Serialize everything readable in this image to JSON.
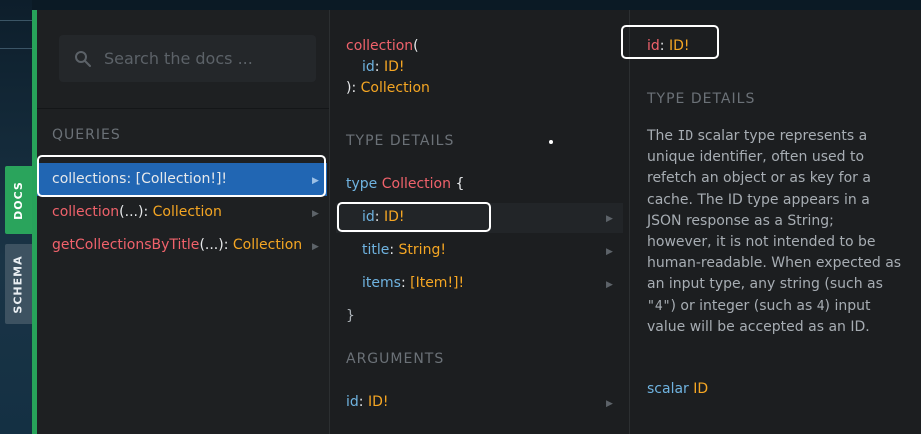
{
  "sidebar": {
    "docs_tab": "DOCS",
    "schema_tab": "SCHEMA"
  },
  "search": {
    "placeholder": "Search the docs ..."
  },
  "queries": {
    "title": "QUERIES",
    "items": [
      {
        "name": "collections",
        "sep": ": ",
        "type": "[Collection!]!",
        "selected": true
      },
      {
        "name": "collection",
        "args": "(...)",
        "sep": ": ",
        "type": "Collection"
      },
      {
        "name": "getCollectionsByTitle",
        "args": "(...)",
        "sep": ": ",
        "type": "Collection"
      }
    ]
  },
  "field_panel": {
    "signature": {
      "name": "collection",
      "open": "(",
      "arg_name": "id",
      "arg_sep": ": ",
      "arg_type": "ID!",
      "close": ")",
      "ret_sep": ": ",
      "ret_type": "Collection"
    },
    "type_details_title": "TYPE DETAILS",
    "type_keyword": "type",
    "type_name": "Collection",
    "open_brace": "{",
    "close_brace": "}",
    "fields": [
      {
        "name": "id",
        "sep": ": ",
        "type": "ID!"
      },
      {
        "name": "title",
        "sep": ": ",
        "type": "String!"
      },
      {
        "name": "items",
        "sep": ": ",
        "type": "[Item!]!"
      }
    ],
    "arguments_title": "ARGUMENTS",
    "arguments": [
      {
        "name": "id",
        "sep": ": ",
        "type": "ID!"
      }
    ]
  },
  "id_panel": {
    "header": {
      "name": "id",
      "sep": ": ",
      "type": "ID!"
    },
    "type_details_title": "TYPE DETAILS",
    "description": {
      "p1": "The ",
      "c1": "ID",
      "p2": " scalar type represents a unique identifier, often used to refetch an object or as key for a cache. The ID type appears in a JSON response as a String; however, it is not intended to be human-readable. When expected as an input type, any string (such as ",
      "c2": "\"4\"",
      "p3": ") or integer (such as ",
      "c3": "4",
      "p4": ") input value will be accepted as an ID."
    },
    "scalar_keyword": "scalar",
    "scalar_name": "ID"
  },
  "icons": [
    "search-icon",
    "chevron-right-icon"
  ],
  "colors": {
    "accent_green": "#27a35a",
    "selected_row": "#2166b3",
    "field_name_red": "#f0626b",
    "type_orange": "#f5a623",
    "keyword_blue": "#6fb3e0"
  }
}
